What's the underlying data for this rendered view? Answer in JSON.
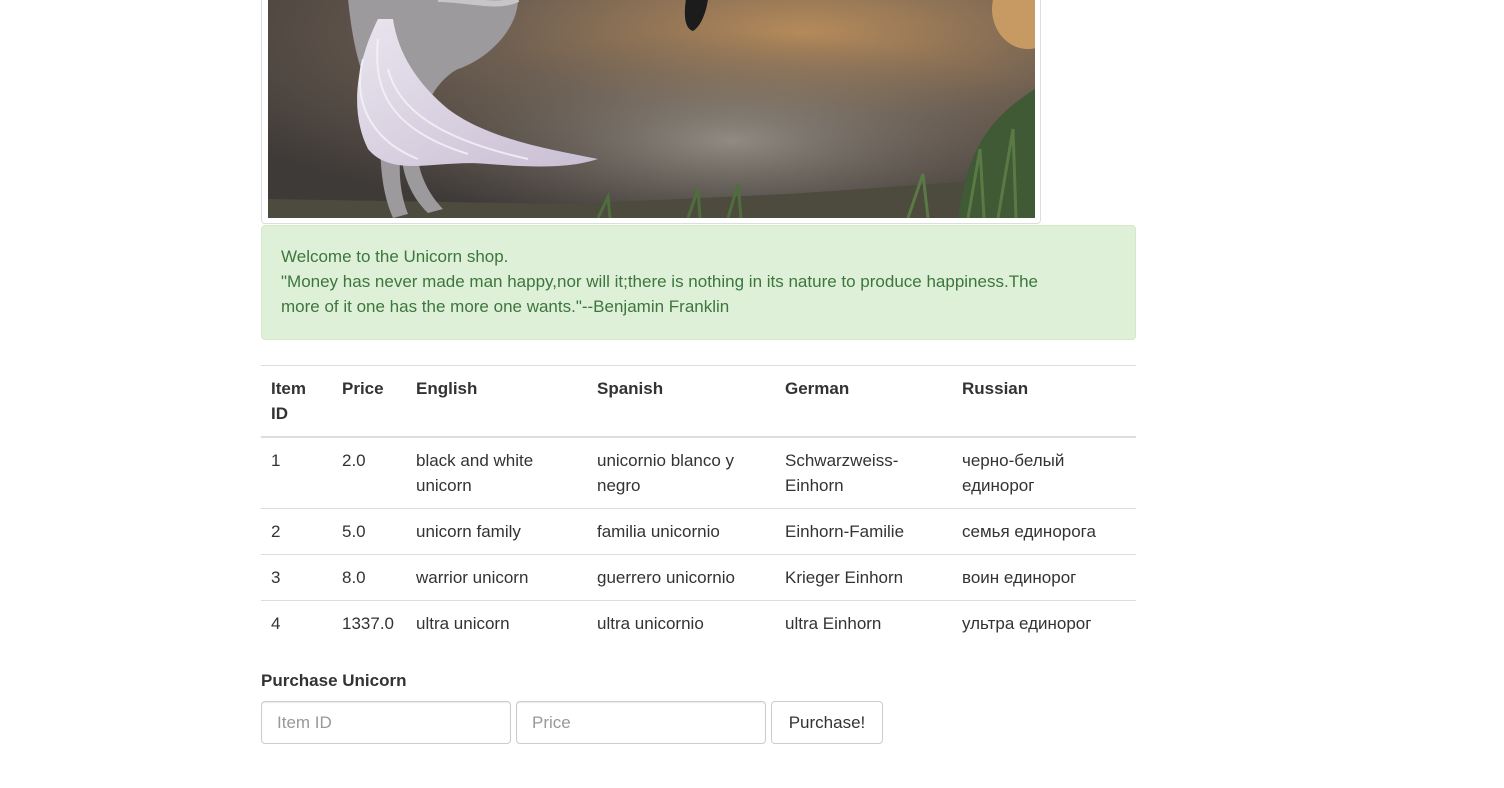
{
  "hero": {
    "image": "unicorn-illustration"
  },
  "alert": {
    "welcome": "Welcome to the Unicorn shop.",
    "quote": "\"Money has never made man happy,nor will it;there is nothing in its nature to produce happiness.The more of it one has the more one wants.\"--Benjamin Franklin"
  },
  "table": {
    "headers": [
      "Item ID",
      "Price",
      "English",
      "Spanish",
      "German",
      "Russian"
    ],
    "rows": [
      [
        "1",
        "2.0",
        "black and white unicorn",
        "unicornio blanco y negro",
        "Schwarzweiss-Einhorn",
        "черно-белый единорог"
      ],
      [
        "2",
        "5.0",
        "unicorn family",
        "familia unicornio",
        "Einhorn-Familie",
        "семья единорога"
      ],
      [
        "3",
        "8.0",
        "warrior unicorn",
        "guerrero unicornio",
        "Krieger Einhorn",
        "воин единорог"
      ],
      [
        "4",
        "1337.0",
        "ultra unicorn",
        "ultra unicornio",
        "ultra Einhorn",
        "ультра единорог"
      ]
    ]
  },
  "purchase": {
    "label": "Purchase Unicorn",
    "item_id_placeholder": "Item ID",
    "item_id_value": "",
    "price_placeholder": "Price",
    "price_value": "",
    "button_label": "Purchase!"
  },
  "colors": {
    "alert_bg": "#dff0d8",
    "alert_text": "#3c763d",
    "table_border": "#dddddd"
  }
}
